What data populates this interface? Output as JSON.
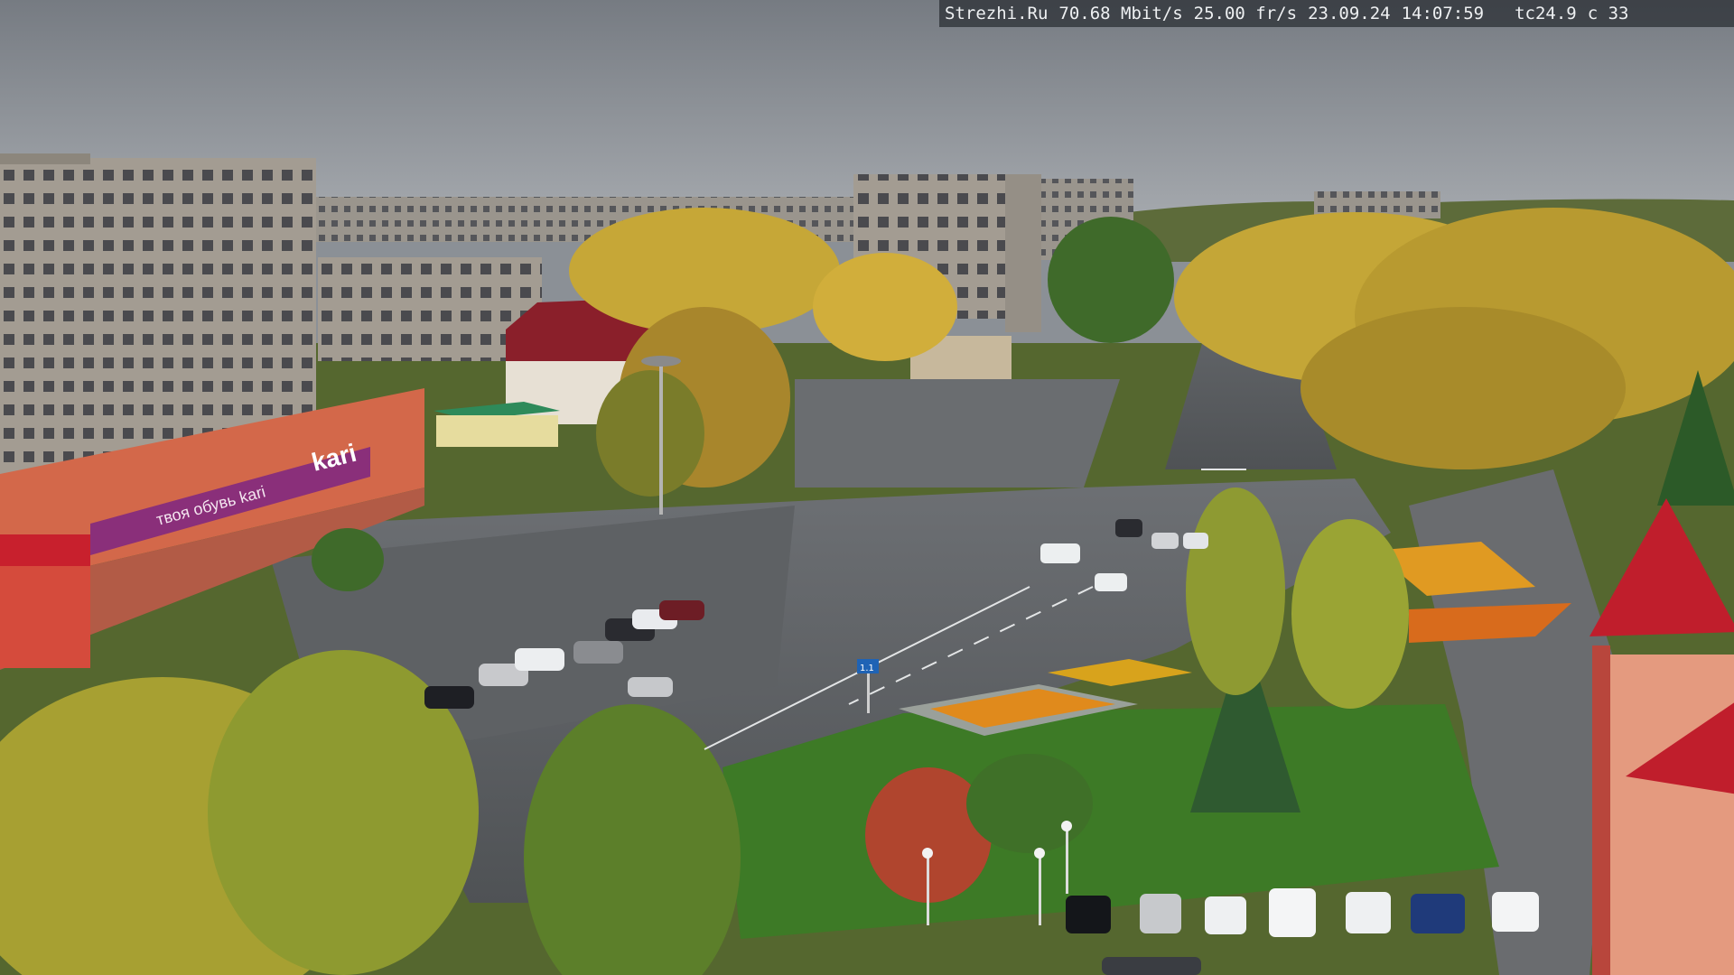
{
  "camera_overlay": {
    "site": "Strezhi.Ru",
    "bitrate": "70.68 Mbit/s",
    "framerate": "25.00 fr/s",
    "date": "23.09.24",
    "time": "14:07:59",
    "tc": "tc24.9",
    "channel": "c 33"
  },
  "signage": {
    "store_logo": "kari",
    "store_slogan": "твоя обувь kari",
    "road_sign_number": "1.1"
  },
  "palette": {
    "sky": "#8d9298",
    "asphalt": "#56595c",
    "grass": "#4f7f2c",
    "foliage_yellow": "#c9a93a",
    "foliage_green": "#6e8a2e",
    "brick_building": "#a59e93",
    "orange_building": "#d3684a",
    "kari_banner": "#8a2f7a",
    "red_roof": "#c01e2c",
    "flowerbed": "#e08a1c"
  }
}
